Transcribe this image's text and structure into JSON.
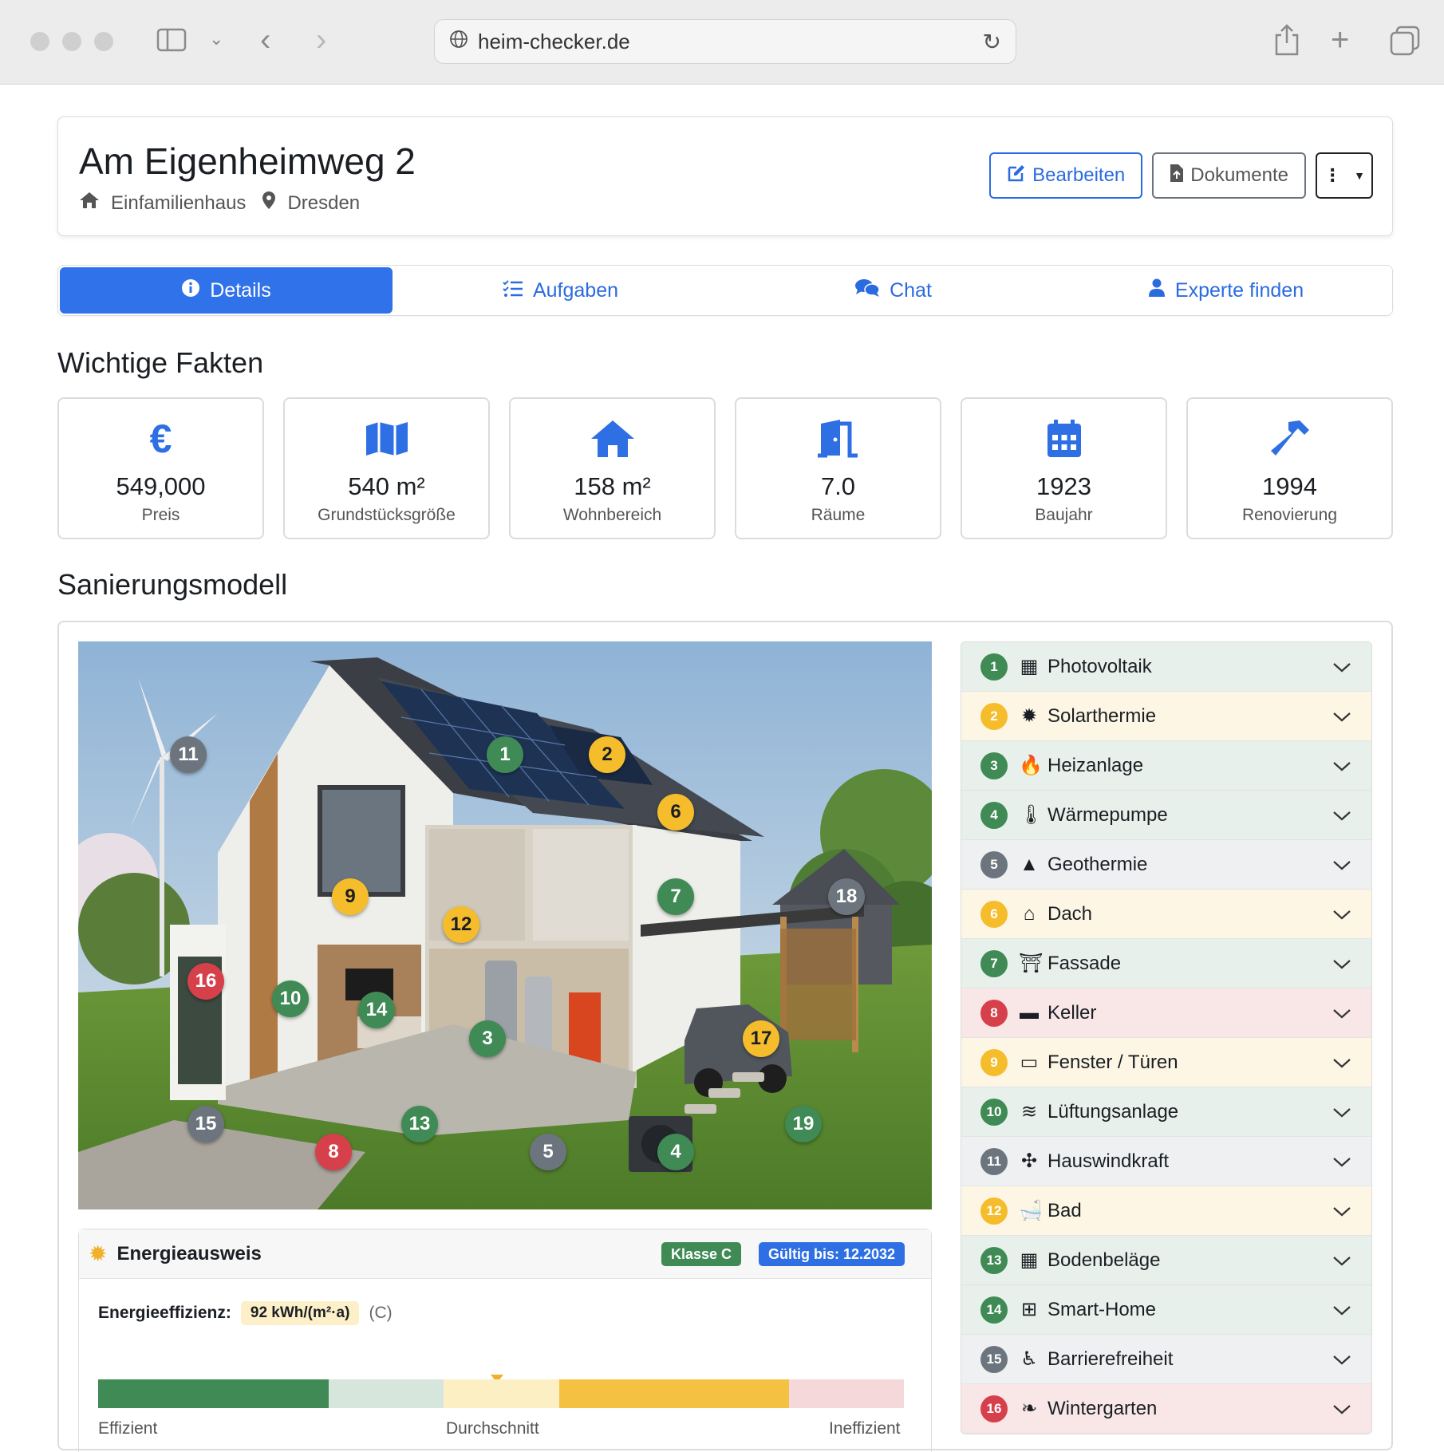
{
  "browser": {
    "url": "heim-checker.de"
  },
  "property": {
    "title": "Am Eigenheimweg 2",
    "type": "Einfamilienhaus",
    "city": "Dresden"
  },
  "actions": {
    "edit": "Bearbeiten",
    "documents": "Dokumente"
  },
  "tabs": [
    {
      "label": "Details",
      "icon": "info-icon"
    },
    {
      "label": "Aufgaben",
      "icon": "tasks-icon"
    },
    {
      "label": "Chat",
      "icon": "chat-icon"
    },
    {
      "label": "Experte finden",
      "icon": "user-icon"
    }
  ],
  "facts_title": "Wichtige Fakten",
  "facts": [
    {
      "value": "549,000",
      "label": "Preis",
      "icon": "euro-icon"
    },
    {
      "value": "540 m²",
      "label": "Grundstücksgröße",
      "icon": "map-icon"
    },
    {
      "value": "158 m²",
      "label": "Wohnbereich",
      "icon": "home-icon"
    },
    {
      "value": "7.0",
      "label": "Räume",
      "icon": "door-icon"
    },
    {
      "value": "1923",
      "label": "Baujahr",
      "icon": "calendar-icon"
    },
    {
      "value": "1994",
      "label": "Renovierung",
      "icon": "hammer-icon"
    }
  ],
  "model_title": "Sanierungsmodell",
  "markers": [
    "1",
    "2",
    "3",
    "4",
    "5",
    "6",
    "7",
    "8",
    "9",
    "10",
    "11",
    "12",
    "13",
    "14",
    "15",
    "16",
    "17",
    "18",
    "19"
  ],
  "energy": {
    "title": "Energieausweis",
    "class_badge": "Klasse C",
    "valid_badge": "Gültig bis: 12.2032",
    "efficiency_label": "Energieeffizienz:",
    "efficiency_value": "92 kWh/(m²·a)",
    "efficiency_class": "(C)",
    "efficiency_value_kwh": 92,
    "scale_labels": {
      "left": "Effizient",
      "mid": "Durchschnitt",
      "right": "Ineffizient"
    },
    "colors": {
      "green": "#3f8a55",
      "lightgreen": "#d6e6dc",
      "lightyellow": "#fdefc4",
      "yellow": "#f5c143",
      "lightred": "#f5d8da"
    }
  },
  "accordion": [
    {
      "num": "1",
      "label": "Photovoltaik",
      "status": "green",
      "icon": "solar-panel-icon"
    },
    {
      "num": "2",
      "label": "Solarthermie",
      "status": "yellow",
      "icon": "sun-icon"
    },
    {
      "num": "3",
      "label": "Heizanlage",
      "status": "green",
      "icon": "fire-icon"
    },
    {
      "num": "4",
      "label": "Wärmepumpe",
      "status": "green",
      "icon": "thermometer-icon"
    },
    {
      "num": "5",
      "label": "Geothermie",
      "status": "gray",
      "icon": "mountain-icon"
    },
    {
      "num": "6",
      "label": "Dach",
      "status": "yellow",
      "icon": "roof-icon"
    },
    {
      "num": "7",
      "label": "Fassade",
      "status": "green",
      "icon": "facade-icon"
    },
    {
      "num": "8",
      "label": "Keller",
      "status": "red",
      "icon": "box-icon"
    },
    {
      "num": "9",
      "label": "Fenster / Türen",
      "status": "yellow",
      "icon": "window-icon"
    },
    {
      "num": "10",
      "label": "Lüftungsanlage",
      "status": "green",
      "icon": "wind-icon"
    },
    {
      "num": "11",
      "label": "Hauswindkraft",
      "status": "gray",
      "icon": "fan-icon"
    },
    {
      "num": "12",
      "label": "Bad",
      "status": "yellow",
      "icon": "bath-icon"
    },
    {
      "num": "13",
      "label": "Bodenbeläge",
      "status": "green",
      "icon": "grid-icon"
    },
    {
      "num": "14",
      "label": "Smart-Home",
      "status": "green",
      "icon": "chip-icon"
    },
    {
      "num": "15",
      "label": "Barrierefreiheit",
      "status": "gray",
      "icon": "wheelchair-icon"
    },
    {
      "num": "16",
      "label": "Wintergarten",
      "status": "red",
      "icon": "leaf-icon"
    }
  ]
}
